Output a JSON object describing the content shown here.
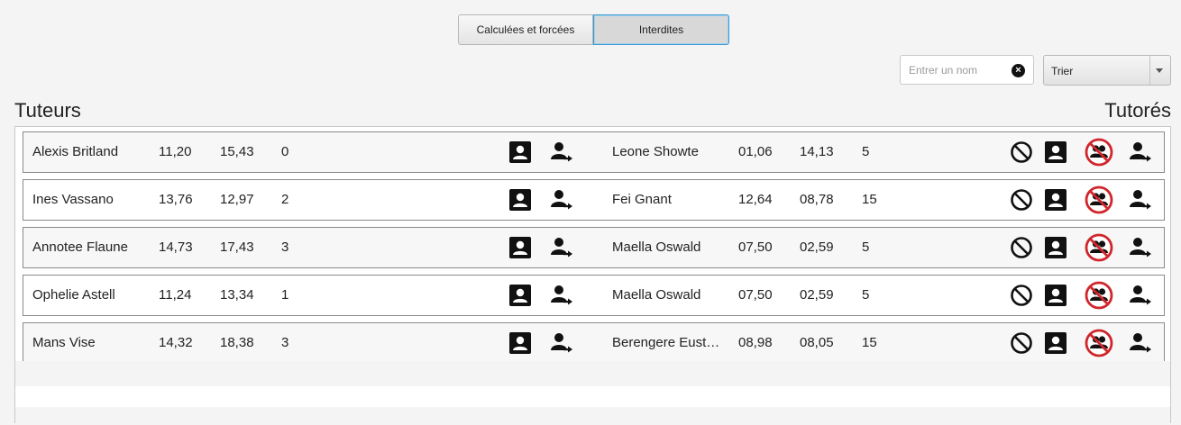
{
  "tabs": [
    {
      "label": "Calculées et forcées",
      "selected": false
    },
    {
      "label": "Interdites",
      "selected": true
    }
  ],
  "search": {
    "placeholder": "Entrer un nom",
    "value": ""
  },
  "sort": {
    "label": "Trier"
  },
  "headers": {
    "left": "Tuteurs",
    "right": "Tutorés"
  },
  "rows": [
    {
      "tutor": {
        "name": "Alexis Britland",
        "a": "11,20",
        "b": "15,43",
        "c": "0"
      },
      "tutee": {
        "name": "Leone Showte",
        "a": "01,06",
        "b": "14,13",
        "c": "5"
      }
    },
    {
      "tutor": {
        "name": "Ines Vassano",
        "a": "13,76",
        "b": "12,97",
        "c": "2"
      },
      "tutee": {
        "name": "Fei Gnant",
        "a": "12,64",
        "b": "08,78",
        "c": "15"
      }
    },
    {
      "tutor": {
        "name": "Annotee Flaune",
        "a": "14,73",
        "b": "17,43",
        "c": "3"
      },
      "tutee": {
        "name": "Maella Oswald",
        "a": "07,50",
        "b": "02,59",
        "c": "5"
      }
    },
    {
      "tutor": {
        "name": "Ophelie Astell",
        "a": "11,24",
        "b": "13,34",
        "c": "1"
      },
      "tutee": {
        "name": "Maella Oswald",
        "a": "07,50",
        "b": "02,59",
        "c": "5"
      }
    },
    {
      "tutor": {
        "name": "Mans Vise",
        "a": "14,32",
        "b": "18,38",
        "c": "3"
      },
      "tutee": {
        "name": "Berengere Eust…",
        "a": "08,98",
        "b": "08,05",
        "c": "15"
      }
    }
  ],
  "icons": [
    "contact-card-icon",
    "move-person-icon",
    "forbidden-icon",
    "no-group-icon"
  ],
  "colors": {
    "accent": "#3d9ad3",
    "forbid_red": "#d0262b"
  }
}
